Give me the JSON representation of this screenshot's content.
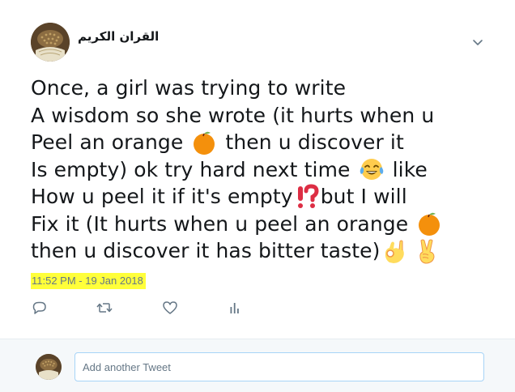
{
  "author": {
    "name": "القران الكريم",
    "avatar_icon": "quran-avatar"
  },
  "menu": {
    "icon": "chevron-down-icon"
  },
  "tweet": {
    "lines": [
      {
        "text_before": "Once, a girl was trying to write"
      },
      {
        "text_before": "A wisdom so she wrote (it hurts when u"
      },
      {
        "text_before": "Peel an orange ",
        "emoji": "orange-emoji",
        "text_after": " then u discover it"
      },
      {
        "text_before": "Is empty) ok try hard next time ",
        "emoji": "tears-of-joy-emoji",
        "text_after": " like"
      },
      {
        "text_before": "How u peel it if it's empty",
        "emoji": "exclamation-question-mark-emoji",
        "text_after": "but I will"
      },
      {
        "text_before": "Fix it (It hurts when u peel an orange ",
        "emoji": "orange-emoji"
      },
      {
        "text_before": "then u discover it has bitter taste)",
        "emoji": "ok-hand-emoji",
        "emoji2": "victory-hand-emoji"
      }
    ],
    "timestamp": "11:52 PM - 19 Jan 2018"
  },
  "actions": [
    {
      "name": "reply",
      "icon": "reply-icon"
    },
    {
      "name": "retweet",
      "icon": "retweet-icon"
    },
    {
      "name": "like",
      "icon": "heart-icon"
    },
    {
      "name": "analytics",
      "icon": "analytics-icon"
    }
  ],
  "reply": {
    "placeholder": "Add another Tweet",
    "value": ""
  },
  "colors": {
    "timestamp_highlight": "#ffff3a",
    "icon_gray": "#657786",
    "input_border": "#a7d4f7",
    "reply_bar_bg": "#f5f8fa"
  }
}
